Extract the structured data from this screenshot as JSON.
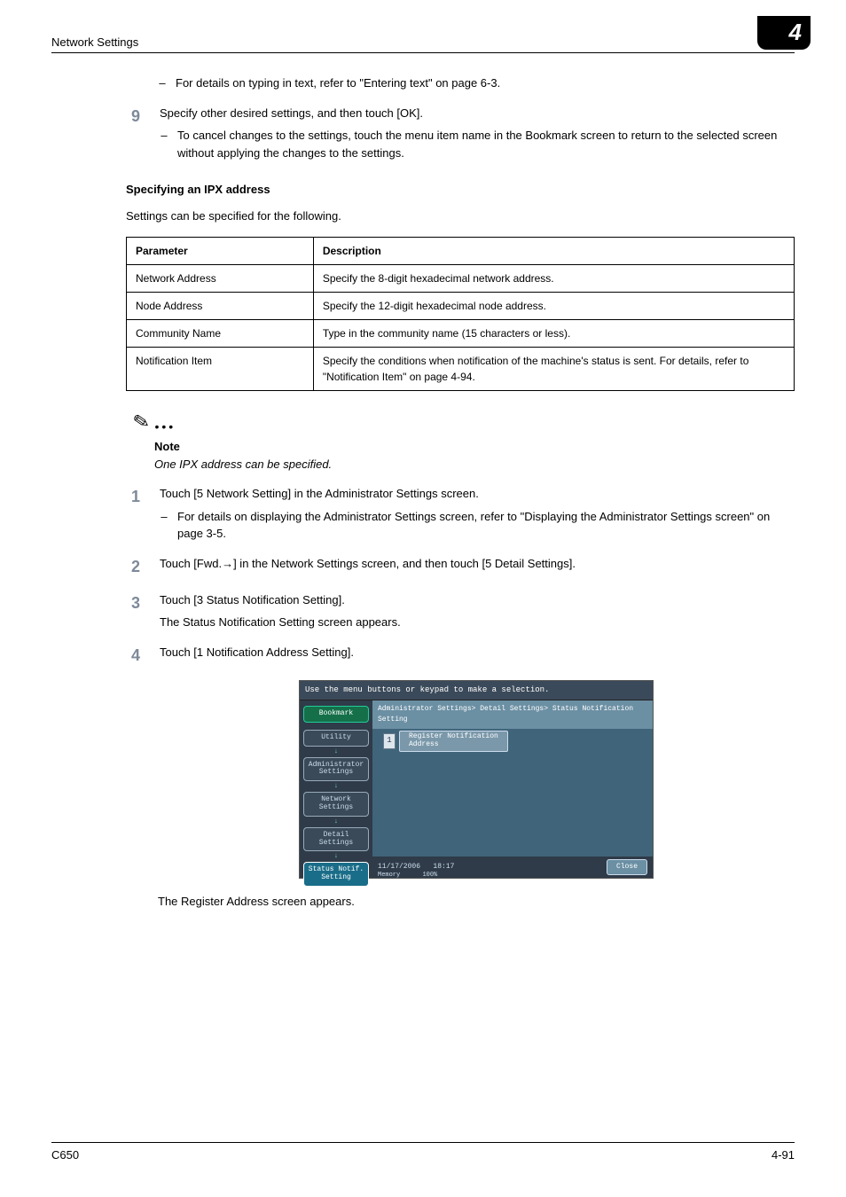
{
  "header": {
    "section": "Network Settings",
    "chapter": "4"
  },
  "initial_sub": {
    "dash": "–",
    "text": "For details on typing in text, refer to \"Entering text\" on page 6-3."
  },
  "step9": {
    "num": "9",
    "text": "Specify other desired settings, and then touch [OK].",
    "sub": {
      "dash": "–",
      "text": "To cancel changes to the settings, touch the menu item name in the Bookmark screen to return to the selected screen without applying the changes to the settings."
    }
  },
  "ipx": {
    "heading": "Specifying an IPX address",
    "intro": "Settings can be specified for the following.",
    "th1": "Parameter",
    "th2": "Description",
    "rows": [
      {
        "p": "Network Address",
        "d": "Specify the 8-digit hexadecimal network address."
      },
      {
        "p": "Node Address",
        "d": "Specify the 12-digit hexadecimal node address."
      },
      {
        "p": "Community Name",
        "d": "Type in the community name (15 characters or less)."
      },
      {
        "p": "Notification Item",
        "d": "Specify the conditions when notification of the machine's status is sent. For details, refer to \"Notification Item\" on page 4-94."
      }
    ]
  },
  "note": {
    "label": "Note",
    "text": "One IPX address can be specified."
  },
  "steps": {
    "s1": {
      "num": "1",
      "text": "Touch [5 Network Setting] in the Administrator Settings screen.",
      "sub": {
        "dash": "–",
        "text": "For details on displaying the Administrator Settings screen, refer to \"Displaying the Administrator Settings screen\" on page 3-5."
      }
    },
    "s2": {
      "num": "2",
      "text": "Touch [Fwd.→] in the Network Settings screen, and then touch [5 Detail Settings]."
    },
    "s3": {
      "num": "3",
      "text": "Touch [3 Status Notification Setting].",
      "after": "The Status Notification Setting screen appears."
    },
    "s4": {
      "num": "4",
      "text": "Touch [1 Notification Address Setting]."
    }
  },
  "mock": {
    "top": "Use the menu buttons or keypad to make a selection.",
    "breadcrumb": "Administrator Settings> Detail Settings> Status Notification Setting",
    "left": {
      "bookmark": "Bookmark",
      "utility": "Utility",
      "admin": "Administrator\nSettings",
      "network": "Network\nSettings",
      "detail": "Detail\nSettings",
      "status": "Status Notif.\nSetting"
    },
    "opt_num": "1",
    "opt_label": "Register Notification\nAddress",
    "date": "11/17/2006",
    "time": "18:17",
    "mem_l": "Memory",
    "mem_v": "100%",
    "close": "Close"
  },
  "result": "The Register Address screen appears.",
  "footer": {
    "left": "C650",
    "right": "4-91"
  }
}
